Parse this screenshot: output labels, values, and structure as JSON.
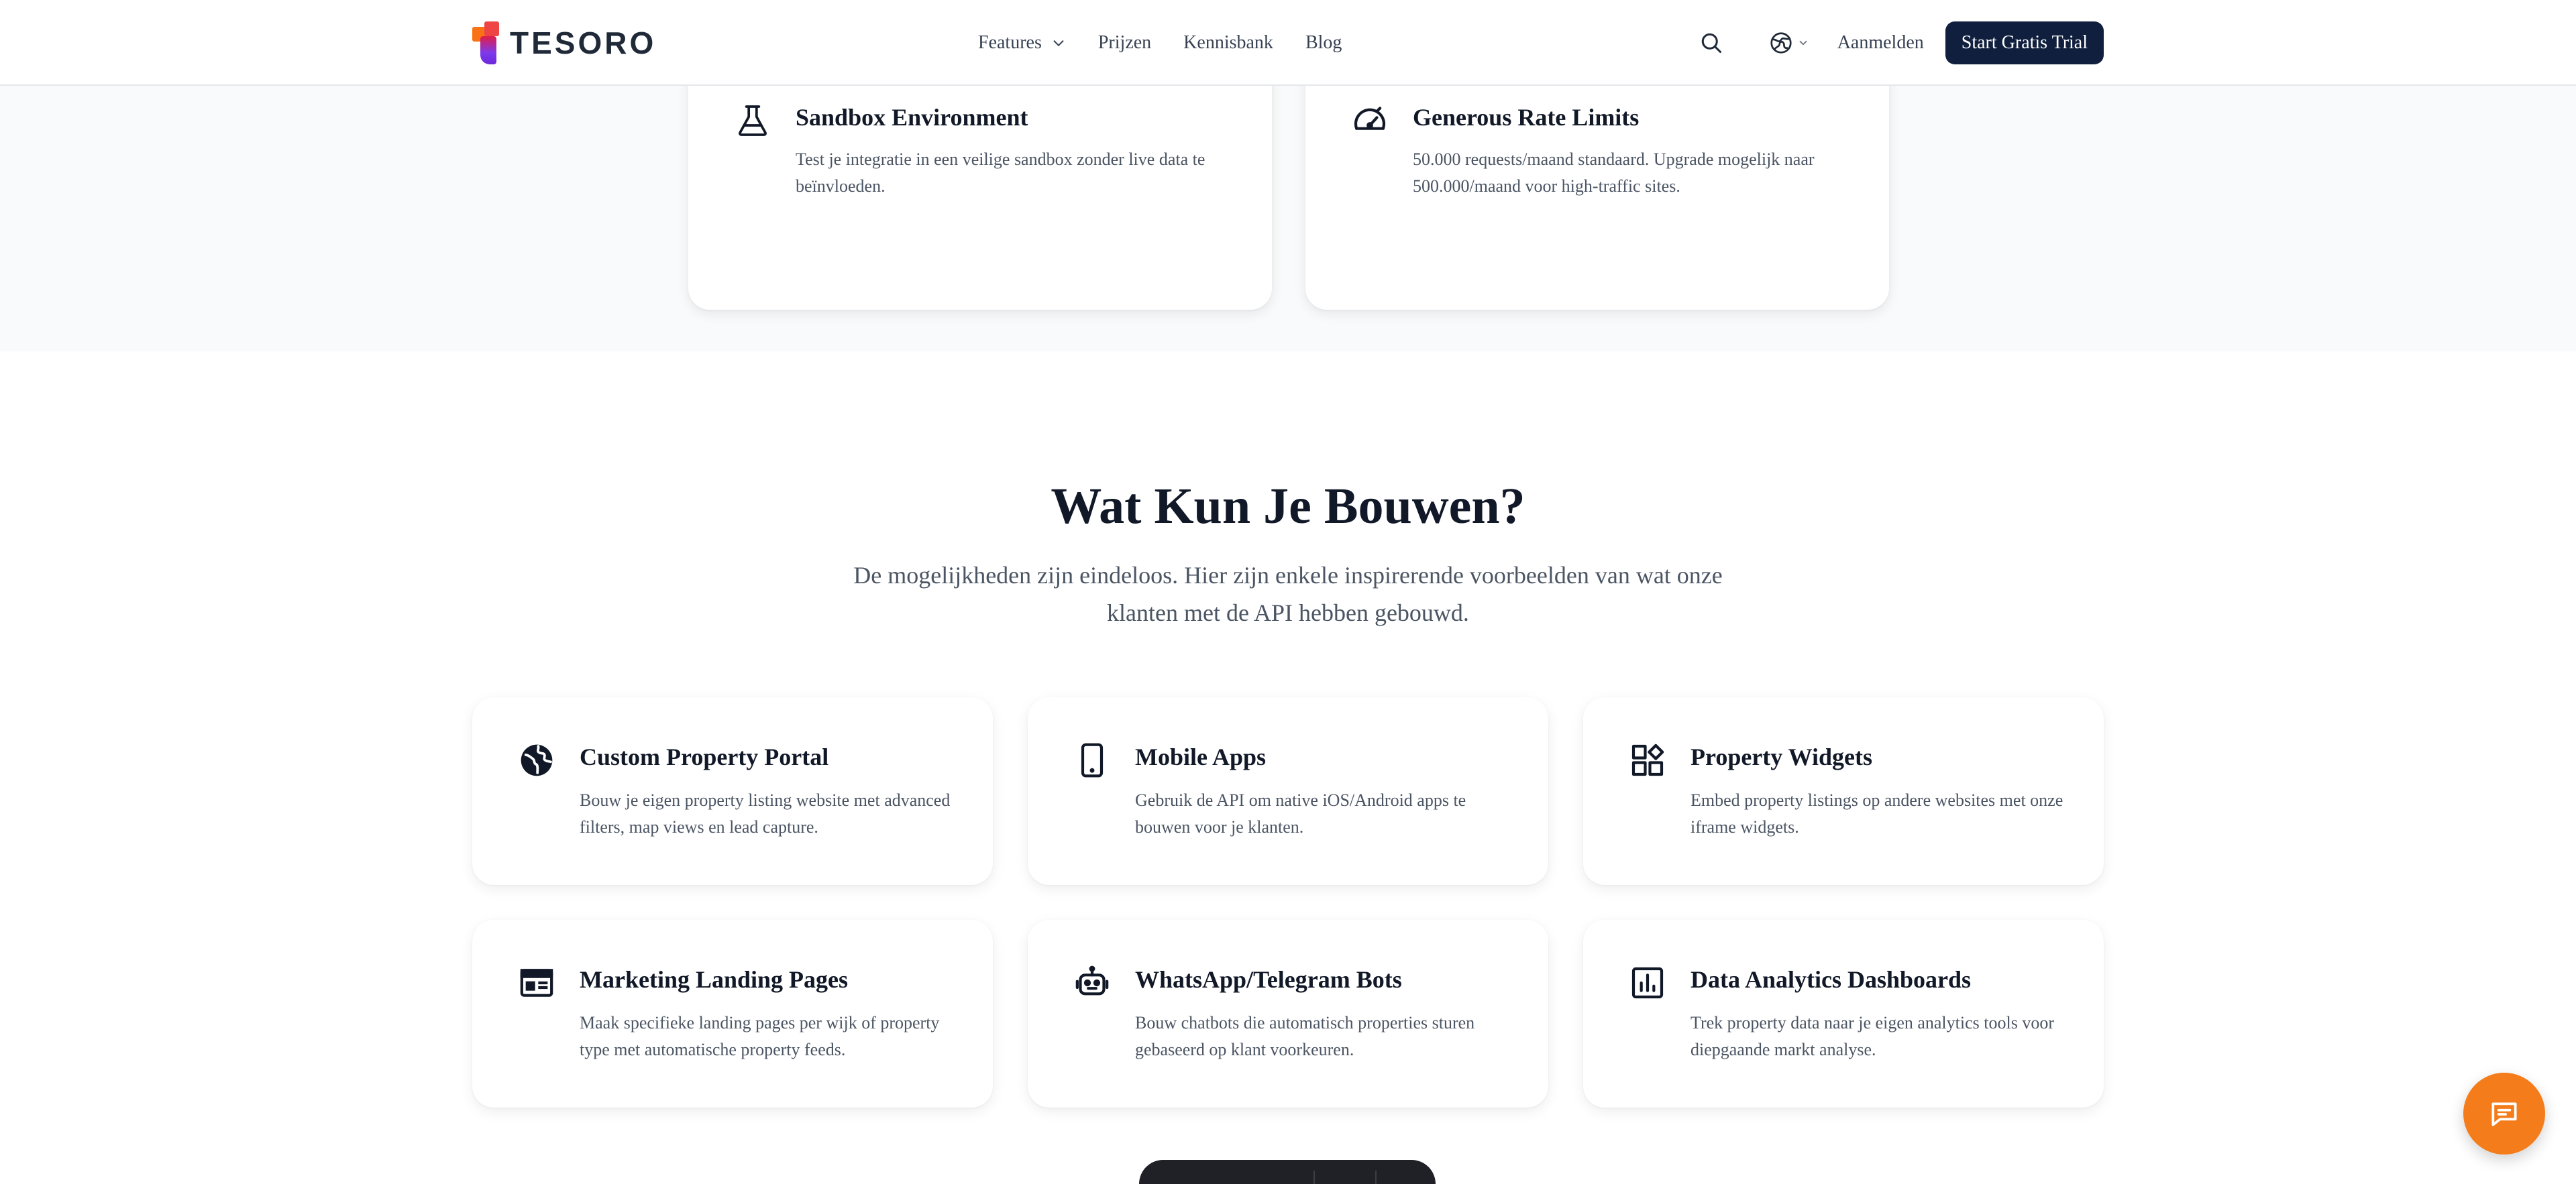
{
  "header": {
    "logo_text": "TESORO",
    "nav": [
      {
        "label": "Features",
        "has_dropdown": true
      },
      {
        "label": "Prijzen"
      },
      {
        "label": "Kennisbank"
      },
      {
        "label": "Blog"
      }
    ],
    "login_label": "Aanmelden",
    "trial_label": "Start Gratis Trial",
    "icons": {
      "search": "search-icon",
      "language": "globe-icon"
    }
  },
  "top_cards": [
    {
      "icon": "flask-icon",
      "title": "Sandbox Environment",
      "desc": "Test je integratie in een veilige sandbox zonder live data te beïnvloeden."
    },
    {
      "icon": "speedometer-icon",
      "title": "Generous Rate Limits",
      "desc": "50.000 requests/maand standaard. Upgrade mogelijk naar 500.000/maand voor high-traffic sites."
    }
  ],
  "section": {
    "title": "Wat Kun Je Bouwen?",
    "subtitle": "De mogelijkheden zijn eindeloos. Hier zijn enkele inspirerende voorbeelden van wat onze klanten met de API hebben gebouwd."
  },
  "cards": [
    {
      "icon": "globe-icon",
      "title": "Custom Property Portal",
      "desc": "Bouw je eigen property listing website met advanced filters, map views en lead capture."
    },
    {
      "icon": "smartphone-icon",
      "title": "Mobile Apps",
      "desc": "Gebruik de API om native iOS/Android apps te bouwen voor je klanten."
    },
    {
      "icon": "widgets-icon",
      "title": "Property Widgets",
      "desc": "Embed property listings op andere websites met onze iframe widgets."
    },
    {
      "icon": "web-page-icon",
      "title": "Marketing Landing Pages",
      "desc": "Maak specifieke landing pages per wijk of property type met automatische property feeds."
    },
    {
      "icon": "robot-icon",
      "title": "WhatsApp/Telegram Bots",
      "desc": "Bouw chatbots die automatisch properties sturen gebaseerd op klant voorkeuren."
    },
    {
      "icon": "analytics-icon",
      "title": "Data Analytics Dashboards",
      "desc": "Trek property data naar je eigen analytics tools voor diepgaande markt analyse."
    }
  ],
  "colors": {
    "primary_button": "#0f1f3d",
    "chat_button": "#f47c1a",
    "band_background": "#f9fafb",
    "heading": "#111827",
    "body_text": "#4b5563"
  }
}
